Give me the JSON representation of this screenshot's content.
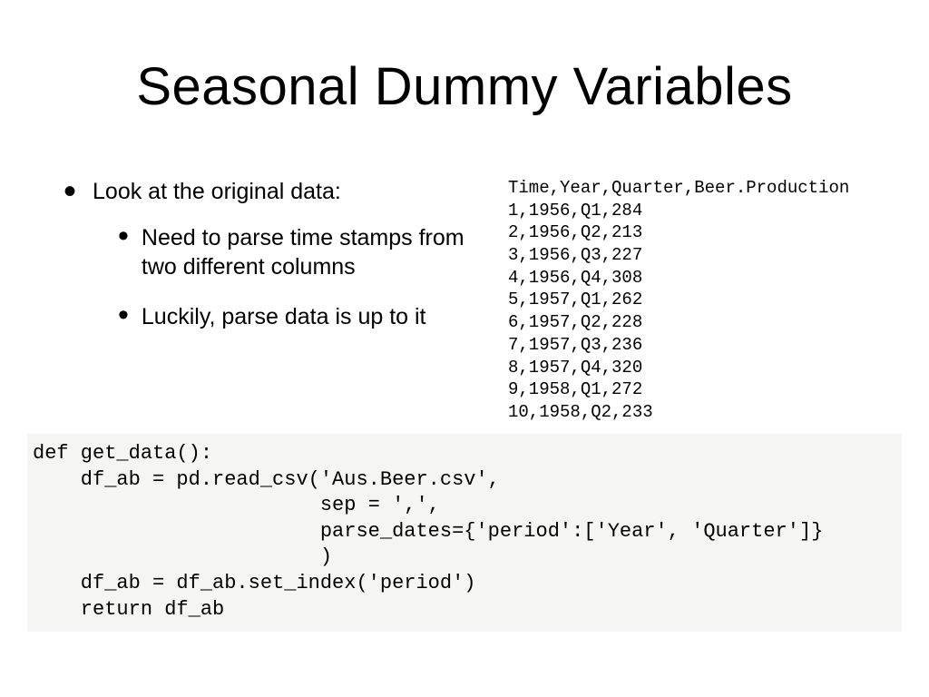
{
  "title": "Seasonal Dummy Variables",
  "bullets": {
    "main": "Look at the original data:",
    "sub1": "Need to parse time stamps from two different columns",
    "sub2": "Luckily, parse data is up to it"
  },
  "data_text": "Time,Year,Quarter,Beer.Production\n1,1956,Q1,284\n2,1956,Q2,213\n3,1956,Q3,227\n4,1956,Q4,308\n5,1957,Q1,262\n6,1957,Q2,228\n7,1957,Q3,236\n8,1957,Q4,320\n9,1958,Q1,272\n10,1958,Q2,233",
  "code_text": "def get_data():\n    df_ab = pd.read_csv('Aus.Beer.csv',\n                        sep = ',',\n                        parse_dates={'period':['Year', 'Quarter']}\n                        )\n    df_ab = df_ab.set_index('period')\n    return df_ab"
}
